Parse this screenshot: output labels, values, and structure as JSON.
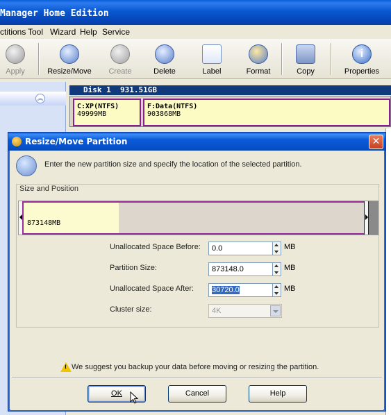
{
  "app": {
    "title": "Manager Home Edition",
    "menu": [
      "ctitions",
      "Tool",
      "Wizard",
      "Help",
      "Service"
    ],
    "toolbar": [
      "Apply",
      "Resize/Move",
      "Create",
      "Delete",
      "Label",
      "Format",
      "Copy",
      "Properties"
    ],
    "disk": {
      "header": "Disk 1  931.51GB",
      "partitions": [
        {
          "name": "C:XP(NTFS)",
          "size": "49999MB"
        },
        {
          "name": "F:Data(NTFS)",
          "size": "903868MB"
        }
      ]
    }
  },
  "dialog": {
    "title": "Resize/Move Partition",
    "close_glyph": "✕",
    "instruction": "Enter the new partition size and specify the location of the selected partition.",
    "group_label": "Size and Position",
    "partition_bar": {
      "size_label": "873148MB",
      "used_fraction": 0.28
    },
    "fields": {
      "unalloc_before": {
        "label": "Unallocated Space Before:",
        "value": "0.0",
        "unit": "MB"
      },
      "partition_size": {
        "label": "Partition Size:",
        "value": "873148.0",
        "unit": "MB"
      },
      "unalloc_after": {
        "label": "Unallocated Space After:",
        "value": "30720.0",
        "unit": "MB"
      },
      "cluster_size": {
        "label": "Cluster size:",
        "value": "4K"
      }
    },
    "warning": "We suggest you backup your data before moving or resizing the partition.",
    "buttons": {
      "ok": "OK",
      "cancel": "Cancel",
      "help": "Help"
    }
  },
  "colors": {
    "title_blue": "#0a5ad8",
    "partition_border": "#9b2d9e",
    "partition_fill": "#fcfbcf",
    "close_red": "#c8401f"
  }
}
